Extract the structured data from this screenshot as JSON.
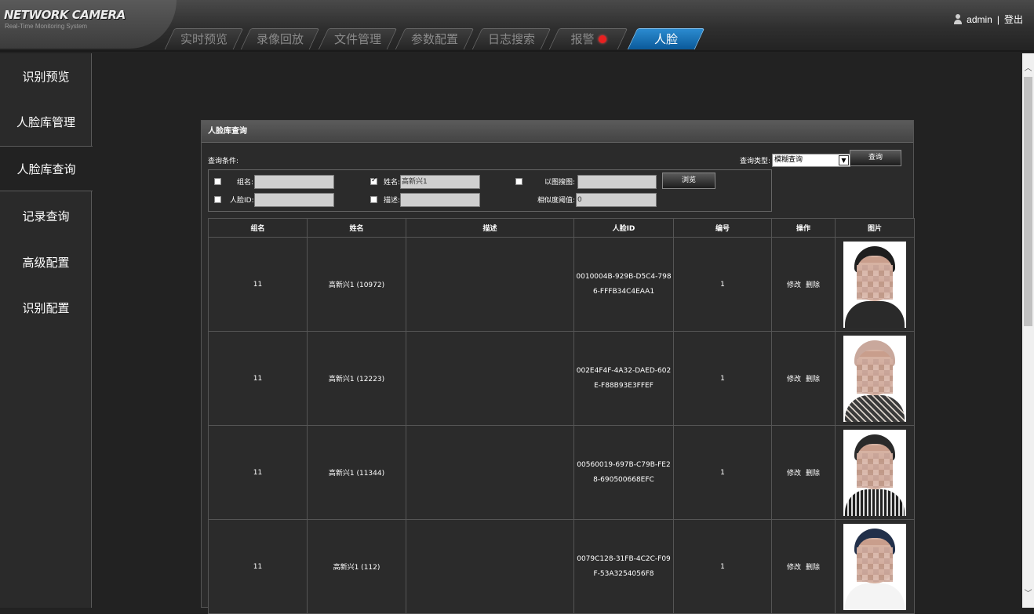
{
  "logo": {
    "title": "NETWORK CAMERA",
    "subtitle": "Real-Time Monitoring System"
  },
  "tabs": [
    {
      "label": "实时预览"
    },
    {
      "label": "录像回放"
    },
    {
      "label": "文件管理"
    },
    {
      "label": "参数配置"
    },
    {
      "label": "日志搜索"
    },
    {
      "label": "报警"
    },
    {
      "label": "人脸",
      "active": true
    }
  ],
  "user": {
    "name": "admin",
    "separator": "|",
    "logout": "登出"
  },
  "sidebar": {
    "items": [
      {
        "label": "识别预览"
      },
      {
        "label": "人脸库管理"
      },
      {
        "label": "人脸库查询",
        "active": true
      },
      {
        "label": "记录查询"
      },
      {
        "label": "高级配置"
      },
      {
        "label": "识别配置"
      }
    ]
  },
  "panel": {
    "title": "人脸库查询",
    "conditions_label": "查询条件:",
    "query_type_label": "查询类型:",
    "query_type_value": "模糊查询",
    "query_button": "查询",
    "browse_button": "浏览",
    "fields": {
      "group": {
        "label": "组名:",
        "value": "",
        "checked": false
      },
      "name": {
        "label": "姓名:",
        "value": "高新兴1",
        "checked": true
      },
      "image_search": {
        "label": "以图搜图:",
        "value": "",
        "checked": false
      },
      "face_id": {
        "label": "人脸ID:",
        "value": "",
        "checked": false
      },
      "desc": {
        "label": "描述:",
        "value": "",
        "checked": false
      },
      "threshold": {
        "label": "相似度阈值:",
        "value": "0"
      }
    }
  },
  "table": {
    "headers": [
      "组名",
      "姓名",
      "描述",
      "人脸ID",
      "编号",
      "操作",
      "图片"
    ],
    "actions": {
      "edit": "修改",
      "delete": "删除"
    },
    "rows": [
      {
        "group": "11",
        "name": "高新兴1 (10972)",
        "desc": "",
        "face_id": "0010004B-929B-D5C4-7986-FFFB34C4EAA1",
        "number": "1"
      },
      {
        "group": "11",
        "name": "高新兴1 (12223)",
        "desc": "",
        "face_id": "002E4F4F-4A32-DAED-602E-F88B93E3FFEF",
        "number": "1"
      },
      {
        "group": "11",
        "name": "高新兴1 (11344)",
        "desc": "",
        "face_id": "00560019-697B-C79B-FE28-690500668EFC",
        "number": "1"
      },
      {
        "group": "11",
        "name": "高新兴1 (112)",
        "desc": "",
        "face_id": "0079C128-31FB-4C2C-F09F-53A3254056F8",
        "number": "1"
      }
    ]
  },
  "colors": {
    "active_tab": "#1a73b8",
    "alarm": "#e82020",
    "background": "#222222"
  }
}
